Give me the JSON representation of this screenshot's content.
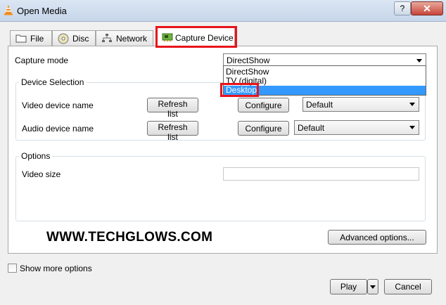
{
  "window": {
    "title": "Open Media",
    "help_label": "?",
    "close_label": "✕"
  },
  "tabs": [
    {
      "label": "File",
      "icon": "folder-icon"
    },
    {
      "label": "Disc",
      "icon": "disc-icon"
    },
    {
      "label": "Network",
      "icon": "network-icon"
    },
    {
      "label": "Capture Device",
      "icon": "capture-card-icon",
      "active": true
    }
  ],
  "capture": {
    "mode_label": "Capture mode",
    "mode_value": "DirectShow",
    "mode_options": [
      "DirectShow",
      "TV (digital)",
      "Desktop"
    ],
    "highlighted_option": "Desktop"
  },
  "device_selection": {
    "title": "Device Selection",
    "video_label": "Video device name",
    "audio_label": "Audio device name",
    "refresh_label": "Refresh list",
    "configure_label": "Configure",
    "video_value": "Default",
    "audio_value": "Default"
  },
  "options": {
    "title": "Options",
    "video_size_label": "Video size",
    "video_size_value": ""
  },
  "watermark": "WWW.TECHGLOWS.COM",
  "advanced_label": "Advanced options...",
  "show_more_label": "Show more options",
  "play_label": "Play",
  "cancel_label": "Cancel",
  "colors": {
    "highlight": "#e8141b",
    "selection": "#3399ff"
  }
}
